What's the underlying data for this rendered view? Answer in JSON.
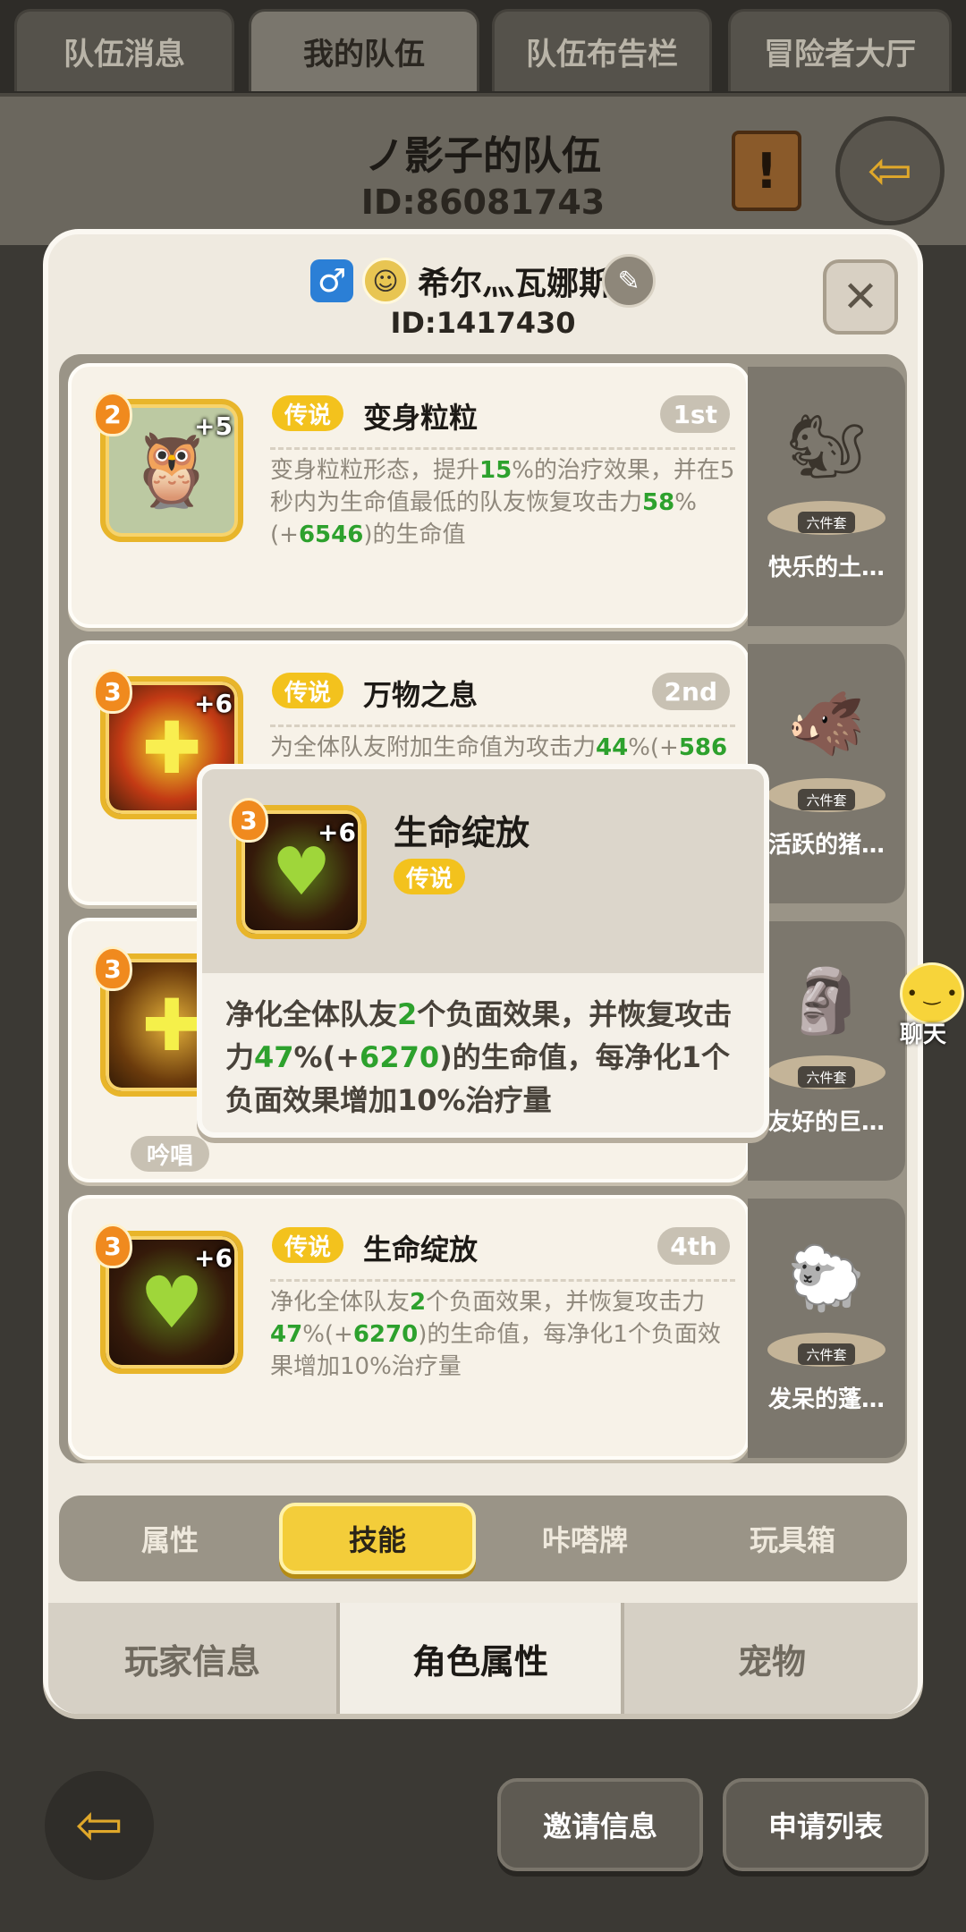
{
  "top_tabs": [
    "队伍消息",
    "我的队伍",
    "队伍布告栏",
    "冒险者大厅"
  ],
  "team": {
    "name": "ノ影子的队伍",
    "id": "ID:86081743"
  },
  "player": {
    "name": "希尔灬瓦娜斯",
    "id": "ID:1417430"
  },
  "skills": [
    {
      "level": "2",
      "plus": "+5",
      "rarity": "传说",
      "title": "变身粒粒",
      "order": "1st",
      "desc": [
        "变身粒粒形态，提升",
        "15",
        "%的治疗效果，并在5秒内为生命值最低的队友恢复攻击力",
        "58",
        "%(+",
        "6546",
        ")的生命值"
      ]
    },
    {
      "level": "3",
      "plus": "+6",
      "rarity": "传说",
      "title": "万物之息",
      "order": "2nd",
      "desc": [
        "为全体队友附加生命值为攻击力",
        "44",
        "%(+",
        "586",
        "",
        "",
        ""
      ]
    },
    {
      "level": "3",
      "plus": "",
      "rarity": "",
      "title": "",
      "order": "",
      "chant": "吟唱"
    },
    {
      "level": "3",
      "plus": "+6",
      "rarity": "传说",
      "title": "生命绽放",
      "order": "4th",
      "desc": [
        "净化全体队友",
        "2",
        "个负面效果，并恢复攻击力",
        "47",
        "%(+",
        "6270",
        ")的生命值，每净化1个负面效果增加10%治疗量"
      ]
    }
  ],
  "sets": [
    {
      "tag": "六件套",
      "name": "快乐的土…"
    },
    {
      "tag": "六件套",
      "name": "活跃的猪…"
    },
    {
      "tag": "六件套",
      "name": "友好的巨…"
    },
    {
      "tag": "六件套",
      "name": "发呆的蓬…"
    }
  ],
  "popup": {
    "level": "3",
    "plus": "+6",
    "title": "生命绽放",
    "rarity": "传说",
    "desc": [
      "净化全体队友",
      "2",
      "个负面效果，并恢复攻击力",
      "47",
      "%(+",
      "6270",
      ")的生命值，每净化1个负面效果增加10%治疗量"
    ]
  },
  "category_tabs": [
    "属性",
    "技能",
    "咔嗒牌",
    "玩具箱"
  ],
  "main_tabs": [
    "玩家信息",
    "角色属性",
    "宠物"
  ],
  "chat_label": "聊天",
  "bottom_buttons": [
    "邀请信息",
    "申请列表"
  ],
  "colors": {
    "accent_yellow": "#f3c21d",
    "highlight_green": "#2da12d",
    "rarity_orange": "#f08a1e"
  }
}
